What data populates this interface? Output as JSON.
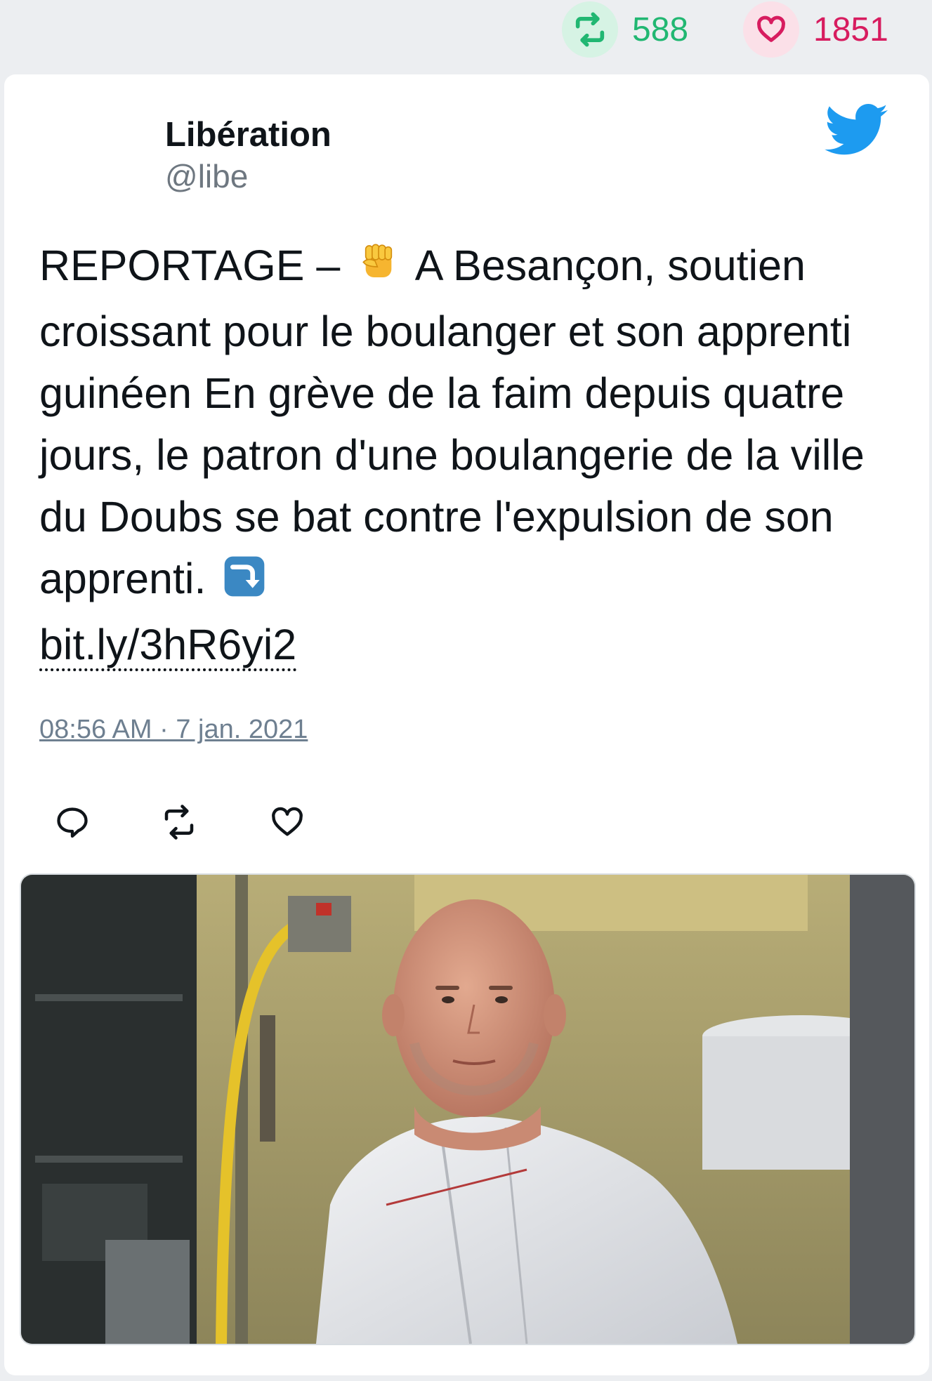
{
  "stats": {
    "retweet_count": "588",
    "like_count": "1851",
    "retweet_color": "#21b772",
    "like_color": "#d71c5f",
    "retweet_icon": "retweet-icon",
    "like_icon": "heart-icon"
  },
  "tweet": {
    "author_name": "Libération",
    "author_handle": "@libe",
    "text_part1": "REPORTAGE – ",
    "emoji1": "raised-fist-emoji",
    "text_part2": " A Besançon, soutien croissant pour le boulanger et son apprenti guinéen En grève de la faim depuis quatre jours, le patron d'une boulangerie de la ville du Doubs se bat contre l'expulsion de son apprenti. ",
    "emoji2": "arrow-right-curving-down-emoji",
    "link": "bit.ly/3hR6yi2",
    "timestamp": "08:56 AM · 7 jan. 2021",
    "brand_color": "#1d9bf0"
  },
  "actions": [
    "reply-icon",
    "retweet-icon",
    "heart-icon"
  ],
  "media": {
    "kind": "photo",
    "subject": "bald-baker-in-white-chef-jacket-in-kitchen"
  }
}
